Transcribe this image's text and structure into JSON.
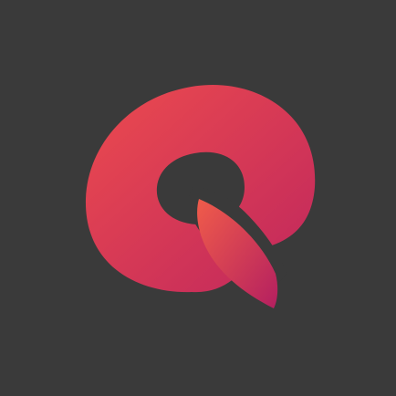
{
  "icon": {
    "name": "q-logo-icon",
    "background_color": "#3a3a3a",
    "ring_gradient": [
      "#e8474f",
      "#c2285a"
    ],
    "tail_gradient": [
      "#ee5a4a",
      "#b51f5e"
    ],
    "hole_color": "#3a3a3a"
  }
}
